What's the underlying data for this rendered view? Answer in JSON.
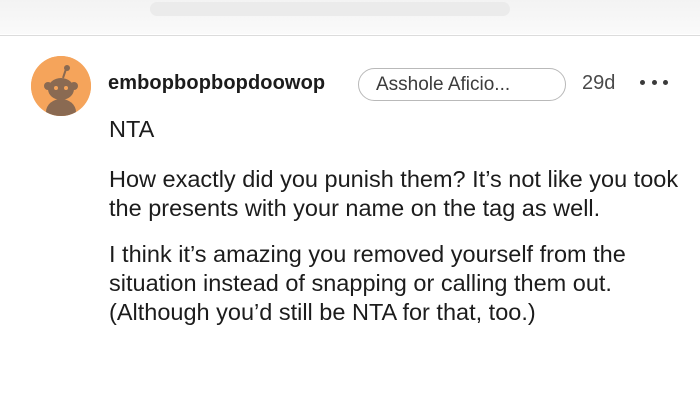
{
  "comment": {
    "username": "embopbopbopdoowop",
    "flair": "Asshole Aficio...",
    "age": "29d",
    "paragraphs": [
      "NTA",
      "How exactly did you punish them? It’s not like you took the presents with your name on the tag as well.",
      "I think it’s amazing you removed yourself from the situation instead of snapping or calling them out. (Although you’d still be NTA for that, too.)"
    ]
  },
  "icons": {
    "avatar": "snoo-avatar-icon",
    "more": "more-options-icon"
  },
  "colors": {
    "avatar_bg": "#f5a45b",
    "avatar_figure": "#8a6a52",
    "text": "#1c1c1c",
    "flair_border": "#b9b9b9"
  }
}
